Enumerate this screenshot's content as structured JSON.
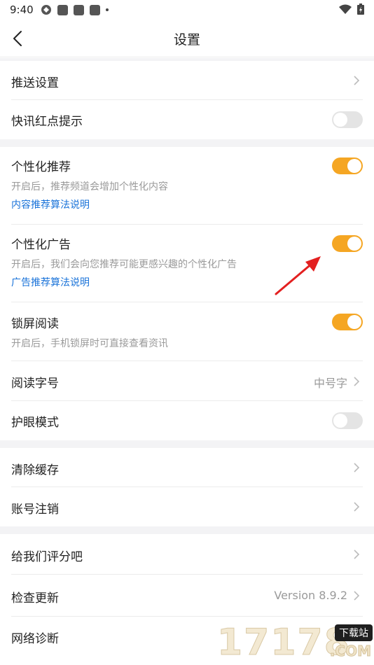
{
  "status_bar": {
    "time": "9:40"
  },
  "header": {
    "title": "设置"
  },
  "items": {
    "push": {
      "label": "推送设置"
    },
    "news_dot": {
      "label": "快讯红点提示",
      "on": false
    },
    "personal_rec": {
      "label": "个性化推荐",
      "desc": "开启后，推荐频道会增加个性化内容",
      "link": "内容推荐算法说明",
      "on": true
    },
    "personal_ad": {
      "label": "个性化广告",
      "desc": "开启后，我们会向您推荐可能更感兴趣的个性化广告",
      "link": "广告推荐算法说明",
      "on": true
    },
    "lock_read": {
      "label": "锁屏阅读",
      "desc": "开启后，手机锁屏时可直接查看资讯",
      "on": true
    },
    "font_size": {
      "label": "阅读字号",
      "value": "中号字"
    },
    "eye_mode": {
      "label": "护眼模式",
      "on": false
    },
    "clear_cache": {
      "label": "清除缓存"
    },
    "delete_account": {
      "label": "账号注销"
    },
    "rate_us": {
      "label": "给我们评分吧"
    },
    "check_update": {
      "label": "检查更新",
      "value": "Version 8.9.2"
    },
    "network_diag": {
      "label": "网络诊断"
    }
  },
  "watermark": {
    "number": "17178",
    "badge": "下载站",
    "suffix": ".COM"
  },
  "colors": {
    "accent": "#f5a623",
    "link": "#1a73d9",
    "arrow": "#e32020"
  }
}
